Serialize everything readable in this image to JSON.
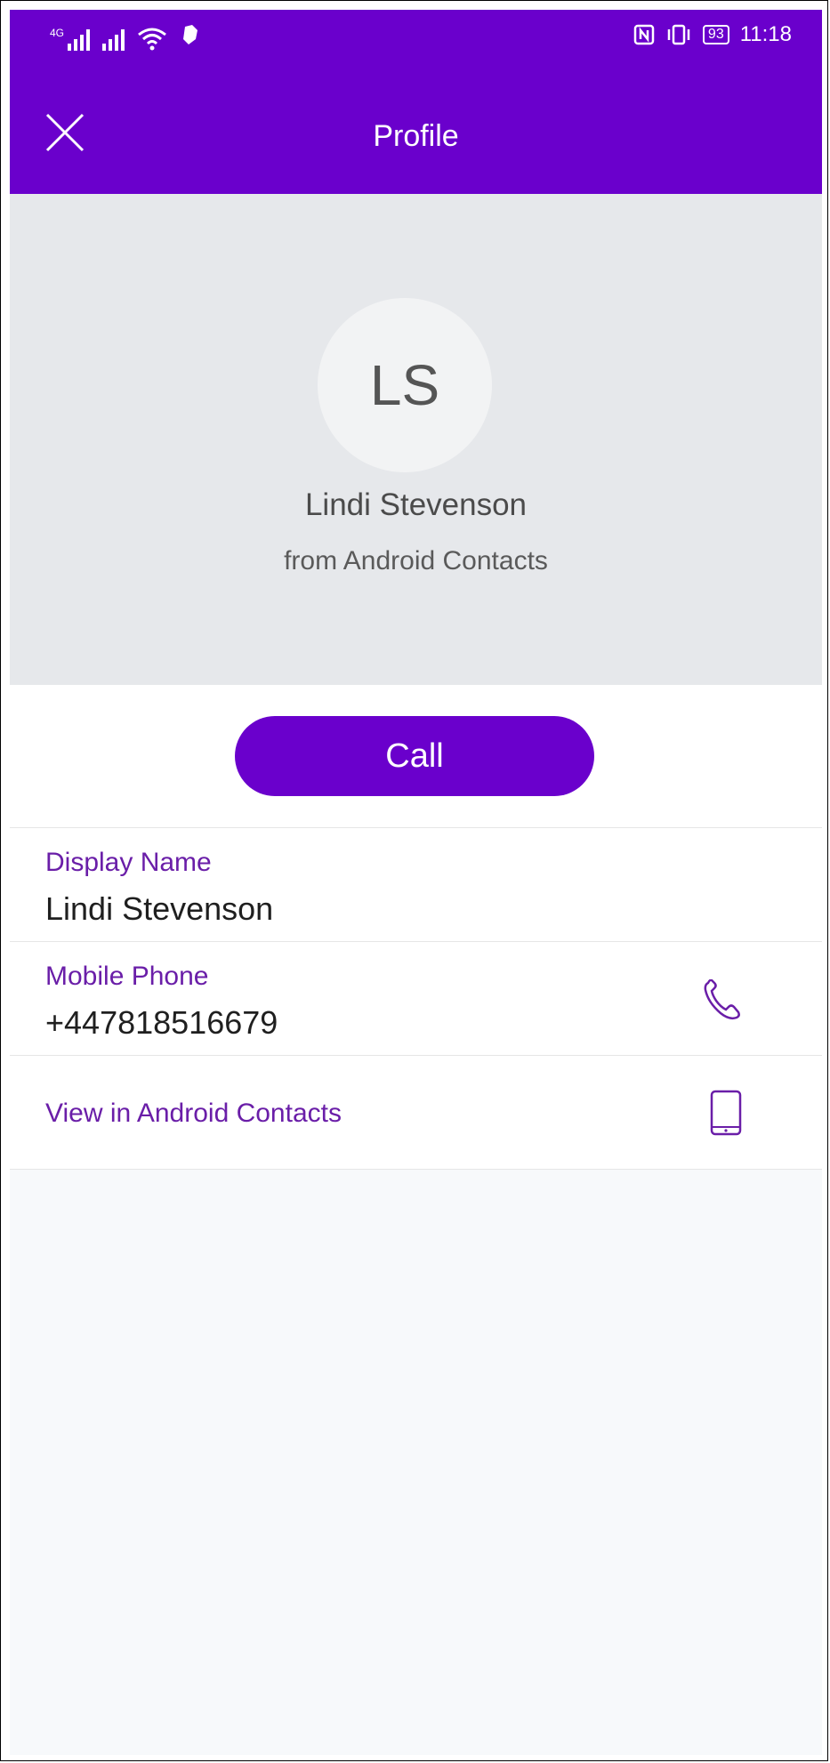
{
  "status_bar": {
    "signal_label": "4G",
    "battery": "93",
    "time": "11:18"
  },
  "header": {
    "title": "Profile",
    "close_icon": "close-icon"
  },
  "profile": {
    "initials": "LS",
    "name": "Lindi Stevenson",
    "source": "from Android Contacts"
  },
  "actions": {
    "call_label": "Call"
  },
  "fields": {
    "display_name_label": "Display Name",
    "display_name_value": "Lindi Stevenson",
    "mobile_label": "Mobile Phone",
    "mobile_value": "+447818516679",
    "view_contacts_label": "View in Android Contacts"
  },
  "colors": {
    "accent": "#6a00cc",
    "label": "#6a1ea8",
    "hero_bg": "#e6e8eb"
  },
  "icons": {
    "phone": "phone-icon",
    "device": "smartphone-icon"
  }
}
